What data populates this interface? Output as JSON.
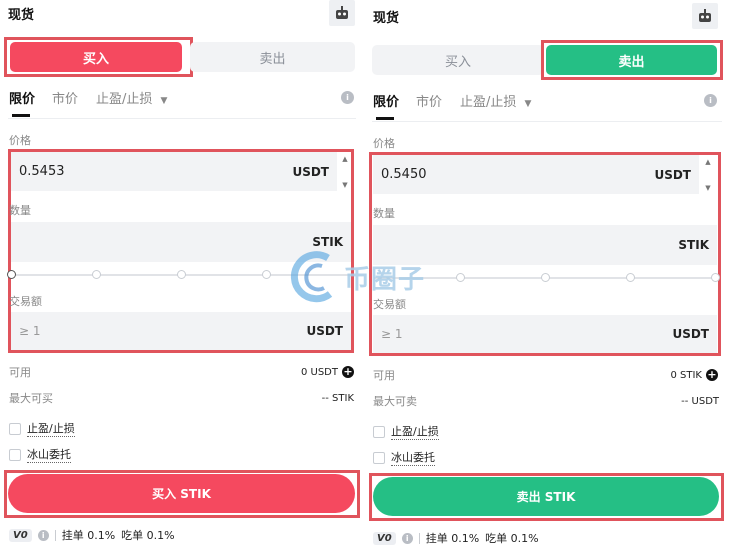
{
  "left": {
    "title": "现货",
    "tabs": {
      "buy": "买入",
      "sell": "卖出"
    },
    "order_types": [
      "限价",
      "市价",
      "止盈/止损"
    ],
    "price_label": "价格",
    "price_value": "0.5453",
    "price_unit": "USDT",
    "qty_label": "数量",
    "qty_unit": "STIK",
    "amount_label": "交易额",
    "amount_placeholder": "≥ 1",
    "amount_unit": "USDT",
    "available_label": "可用",
    "available_value": "0 USDT",
    "max_label": "最大可买",
    "max_value": "-- STIK",
    "tpsl_label": "止盈/止损",
    "iceberg_label": "冰山委托",
    "submit_label": "买入 STIK",
    "vip": "V0",
    "maker_fee": "挂单 0.1%",
    "taker_fee": "吃单 0.1%"
  },
  "right": {
    "title": "现货",
    "tabs": {
      "buy": "买入",
      "sell": "卖出"
    },
    "order_types": [
      "限价",
      "市价",
      "止盈/止损"
    ],
    "price_label": "价格",
    "price_value": "0.5450",
    "price_unit": "USDT",
    "qty_label": "数量",
    "qty_unit": "STIK",
    "amount_label": "交易额",
    "amount_placeholder": "≥ 1",
    "amount_unit": "USDT",
    "available_label": "可用",
    "available_value": "0 STIK",
    "max_label": "最大可卖",
    "max_value": "-- USDT",
    "tpsl_label": "止盈/止损",
    "iceberg_label": "冰山委托",
    "submit_label": "卖出 STIK",
    "vip": "V0",
    "maker_fee": "挂单 0.1%",
    "taker_fee": "吃单 0.1%"
  },
  "watermark": "币圈子",
  "colors": {
    "buy": "#f5495f",
    "sell": "#25bf85",
    "highlight": "#e0545c"
  }
}
